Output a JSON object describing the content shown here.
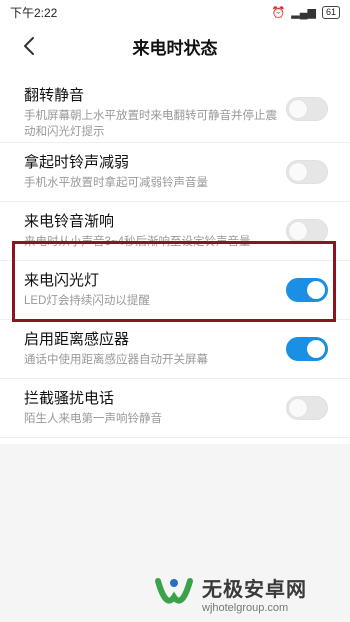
{
  "status_bar": {
    "time": "下午2:22",
    "battery": "61"
  },
  "header": {
    "title": "来电时状态"
  },
  "settings": [
    {
      "label": "翻转静音",
      "desc": "手机屏幕朝上水平放置时来电翻转可静音并停止震动和闪光灯提示",
      "enabled": false
    },
    {
      "label": "拿起时铃声减弱",
      "desc": "手机水平放置时拿起可减弱铃声音量",
      "enabled": false
    },
    {
      "label": "来电铃音渐响",
      "desc": "来电时从小声音3~4秒后渐响至设定铃声音量",
      "enabled": false
    },
    {
      "label": "来电闪光灯",
      "desc": "LED灯会持续闪动以提醒",
      "enabled": true
    },
    {
      "label": "启用距离感应器",
      "desc": "通话中使用距离感应器自动开关屏幕",
      "enabled": true
    },
    {
      "label": "拦截骚扰电话",
      "desc": "陌生人来电第一声响铃静音",
      "enabled": false
    }
  ],
  "watermark": {
    "name": "无极安卓网",
    "url": "wjhotelgroup.com"
  },
  "colors": {
    "toggle_on": "#1a8fe3",
    "highlight": "#8b1420"
  }
}
